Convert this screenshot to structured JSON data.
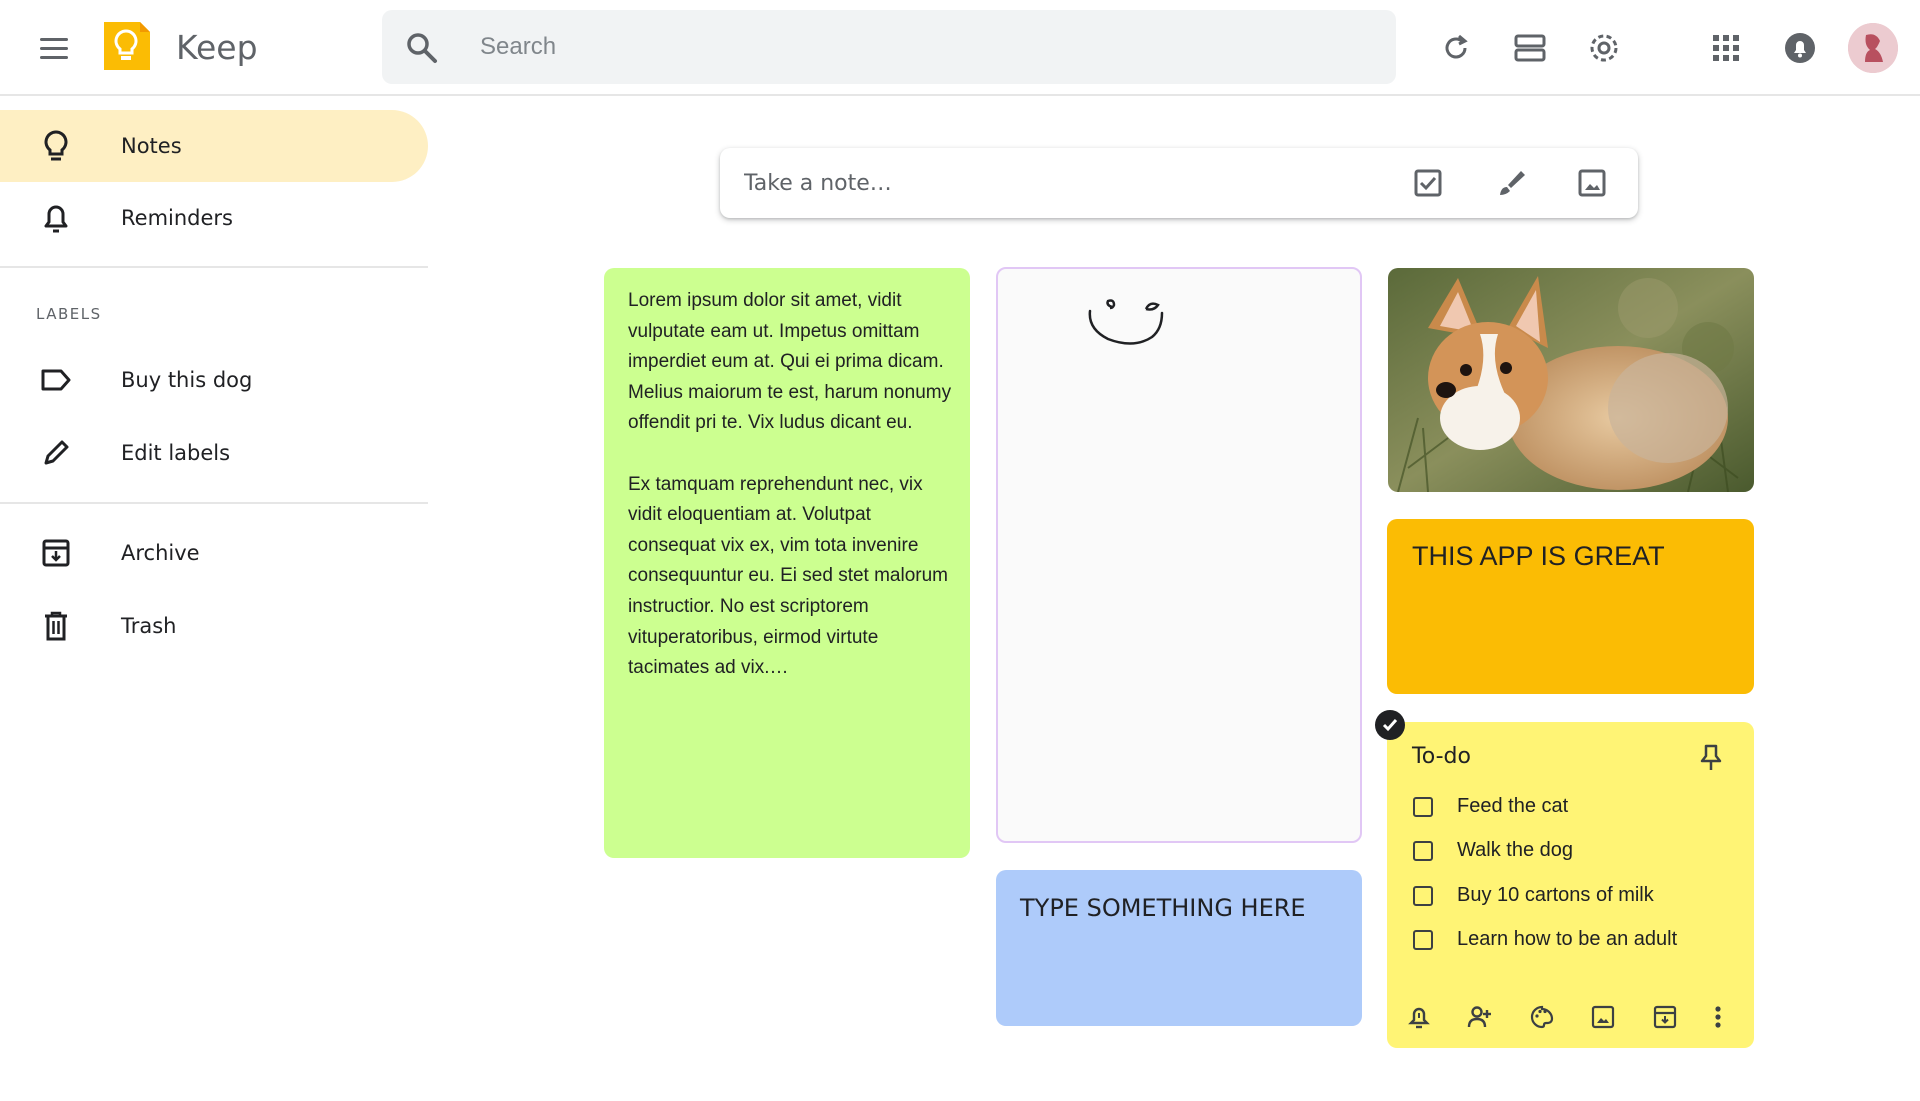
{
  "header": {
    "app_name": "Keep",
    "search_placeholder": "Search",
    "icons": [
      "menu-icon",
      "keep-logo",
      "search-icon",
      "refresh-icon",
      "list-view-icon",
      "settings-icon",
      "apps-grid-icon",
      "notifications-icon",
      "account-avatar"
    ]
  },
  "sidebar": {
    "items": [
      {
        "label": "Notes",
        "icon": "lightbulb-icon",
        "active": true
      },
      {
        "label": "Reminders",
        "icon": "bell-icon",
        "active": false
      }
    ],
    "labels_heading": "LABELS",
    "label_items": [
      {
        "label": "Buy this dog",
        "icon": "label-icon"
      },
      {
        "label": "Edit labels",
        "icon": "pencil-icon"
      }
    ],
    "bottom_items": [
      {
        "label": "Archive",
        "icon": "archive-icon"
      },
      {
        "label": "Trash",
        "icon": "trash-icon"
      }
    ]
  },
  "take_note": {
    "placeholder": "Take a note…",
    "icons": [
      "new-list-icon",
      "new-drawing-icon",
      "new-image-icon"
    ]
  },
  "notes": {
    "lorem": {
      "color": "#ccff90",
      "paragraphs": [
        "Lorem ipsum dolor sit amet, vidit vulputate eam ut. Impetus omittam imperdiet eum at. Qui ei prima dicam. Melius maiorum te est, harum nonumy offendit pri te. Vix ludus dicant eu.",
        "Ex tamquam reprehendunt nec, vix vidit eloquentiam at. Volutpat consequat vix ex, vim tota invenire consequuntur eu. Ei sed stet malorum instructior. No est scriptorem vituperatoribus, eirmod virtute tacimates ad vix.…"
      ]
    },
    "drawing": {
      "color": "#fafafa",
      "border": "#e1c7f5"
    },
    "photo": {
      "subject": "corgi-puppy-photo"
    },
    "great": {
      "color": "#fbbc04",
      "title": "THIS APP IS GREAT"
    },
    "type_something": {
      "color": "#aecbfa",
      "title": "TYPE SOMETHING HERE"
    },
    "todo": {
      "color": "#fff475",
      "title": "To-do",
      "items": [
        "Feed the cat",
        "Walk the dog",
        "Buy 10 cartons of milk",
        "Learn how to be an adult"
      ],
      "actions": [
        "remind-icon",
        "collaborator-icon",
        "palette-icon",
        "add-image-icon",
        "archive-icon",
        "more-icon"
      ]
    }
  }
}
